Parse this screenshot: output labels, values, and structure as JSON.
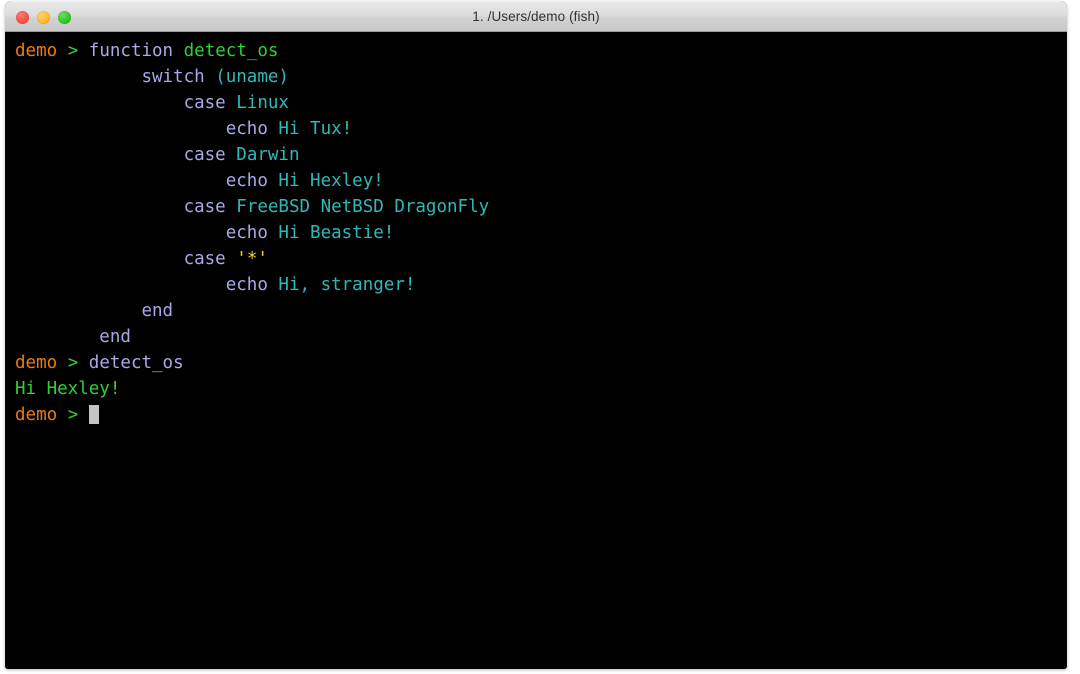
{
  "window": {
    "title": "1. /Users/demo (fish)",
    "traffic_lights": [
      {
        "name": "close",
        "label": "Close",
        "color": "#fb4f45"
      },
      {
        "name": "minimize",
        "label": "Minimize",
        "color": "#feb82c"
      },
      {
        "name": "maximize",
        "label": "Maximize",
        "color": "#2fc42a"
      }
    ]
  },
  "theme": {
    "background": "#000000",
    "prompt_user": "#ef7a0c",
    "prompt_arrow": "#2fd12f",
    "keyword": "#a9a9e8",
    "function_name": "#2fd12f",
    "parameter": "#2fb8b8",
    "string": "#e6d825",
    "command": "#a9a9e8",
    "output": "#2fd12f",
    "cursor": "#c4c4c4",
    "titlebar": "#dcdcdc",
    "titlebar_text": "#31312f"
  },
  "terminal": {
    "shell": "fish",
    "prompt_user": "demo",
    "prompt_symbol": ">",
    "lines": [
      {
        "type": "prompt",
        "indent": 0,
        "segments": [
          {
            "text": "demo",
            "style": "prompt-user"
          },
          {
            "text": " ",
            "style": "plain"
          },
          {
            "text": ">",
            "style": "prompt-arrow"
          },
          {
            "text": " ",
            "style": "plain"
          },
          {
            "text": "function",
            "style": "keyword"
          },
          {
            "text": " ",
            "style": "plain"
          },
          {
            "text": "detect_os",
            "style": "funcdef"
          }
        ]
      },
      {
        "type": "continuation",
        "indent": 12,
        "segments": [
          {
            "text": "switch",
            "style": "keyword"
          },
          {
            "text": " ",
            "style": "plain"
          },
          {
            "text": "(uname)",
            "style": "param"
          }
        ]
      },
      {
        "type": "continuation",
        "indent": 16,
        "segments": [
          {
            "text": "case",
            "style": "keyword"
          },
          {
            "text": " ",
            "style": "plain"
          },
          {
            "text": "Linux",
            "style": "param"
          }
        ]
      },
      {
        "type": "continuation",
        "indent": 20,
        "segments": [
          {
            "text": "echo",
            "style": "keyword"
          },
          {
            "text": " ",
            "style": "plain"
          },
          {
            "text": "Hi Tux!",
            "style": "param"
          }
        ]
      },
      {
        "type": "continuation",
        "indent": 16,
        "segments": [
          {
            "text": "case",
            "style": "keyword"
          },
          {
            "text": " ",
            "style": "plain"
          },
          {
            "text": "Darwin",
            "style": "param"
          }
        ]
      },
      {
        "type": "continuation",
        "indent": 20,
        "segments": [
          {
            "text": "echo",
            "style": "keyword"
          },
          {
            "text": " ",
            "style": "plain"
          },
          {
            "text": "Hi Hexley!",
            "style": "param"
          }
        ]
      },
      {
        "type": "continuation",
        "indent": 16,
        "segments": [
          {
            "text": "case",
            "style": "keyword"
          },
          {
            "text": " ",
            "style": "plain"
          },
          {
            "text": "FreeBSD NetBSD DragonFly",
            "style": "param"
          }
        ]
      },
      {
        "type": "continuation",
        "indent": 20,
        "segments": [
          {
            "text": "echo",
            "style": "keyword"
          },
          {
            "text": " ",
            "style": "plain"
          },
          {
            "text": "Hi Beastie!",
            "style": "param"
          }
        ]
      },
      {
        "type": "continuation",
        "indent": 16,
        "segments": [
          {
            "text": "case",
            "style": "keyword"
          },
          {
            "text": " ",
            "style": "plain"
          },
          {
            "text": "'*'",
            "style": "string"
          }
        ]
      },
      {
        "type": "continuation",
        "indent": 20,
        "segments": [
          {
            "text": "echo",
            "style": "keyword"
          },
          {
            "text": " ",
            "style": "plain"
          },
          {
            "text": "Hi, stranger!",
            "style": "param"
          }
        ]
      },
      {
        "type": "continuation",
        "indent": 12,
        "segments": [
          {
            "text": "end",
            "style": "keyword"
          }
        ]
      },
      {
        "type": "continuation",
        "indent": 8,
        "segments": [
          {
            "text": "end",
            "style": "keyword"
          }
        ]
      },
      {
        "type": "prompt",
        "indent": 0,
        "segments": [
          {
            "text": "demo",
            "style": "prompt-user"
          },
          {
            "text": " ",
            "style": "plain"
          },
          {
            "text": ">",
            "style": "prompt-arrow"
          },
          {
            "text": " ",
            "style": "plain"
          },
          {
            "text": "detect_os",
            "style": "command"
          }
        ]
      },
      {
        "type": "output",
        "indent": 0,
        "segments": [
          {
            "text": "Hi Hexley!",
            "style": "output"
          }
        ]
      },
      {
        "type": "prompt-active",
        "indent": 0,
        "cursor": true,
        "segments": [
          {
            "text": "demo",
            "style": "prompt-user"
          },
          {
            "text": " ",
            "style": "plain"
          },
          {
            "text": ">",
            "style": "prompt-arrow"
          },
          {
            "text": " ",
            "style": "plain"
          }
        ]
      }
    ]
  }
}
